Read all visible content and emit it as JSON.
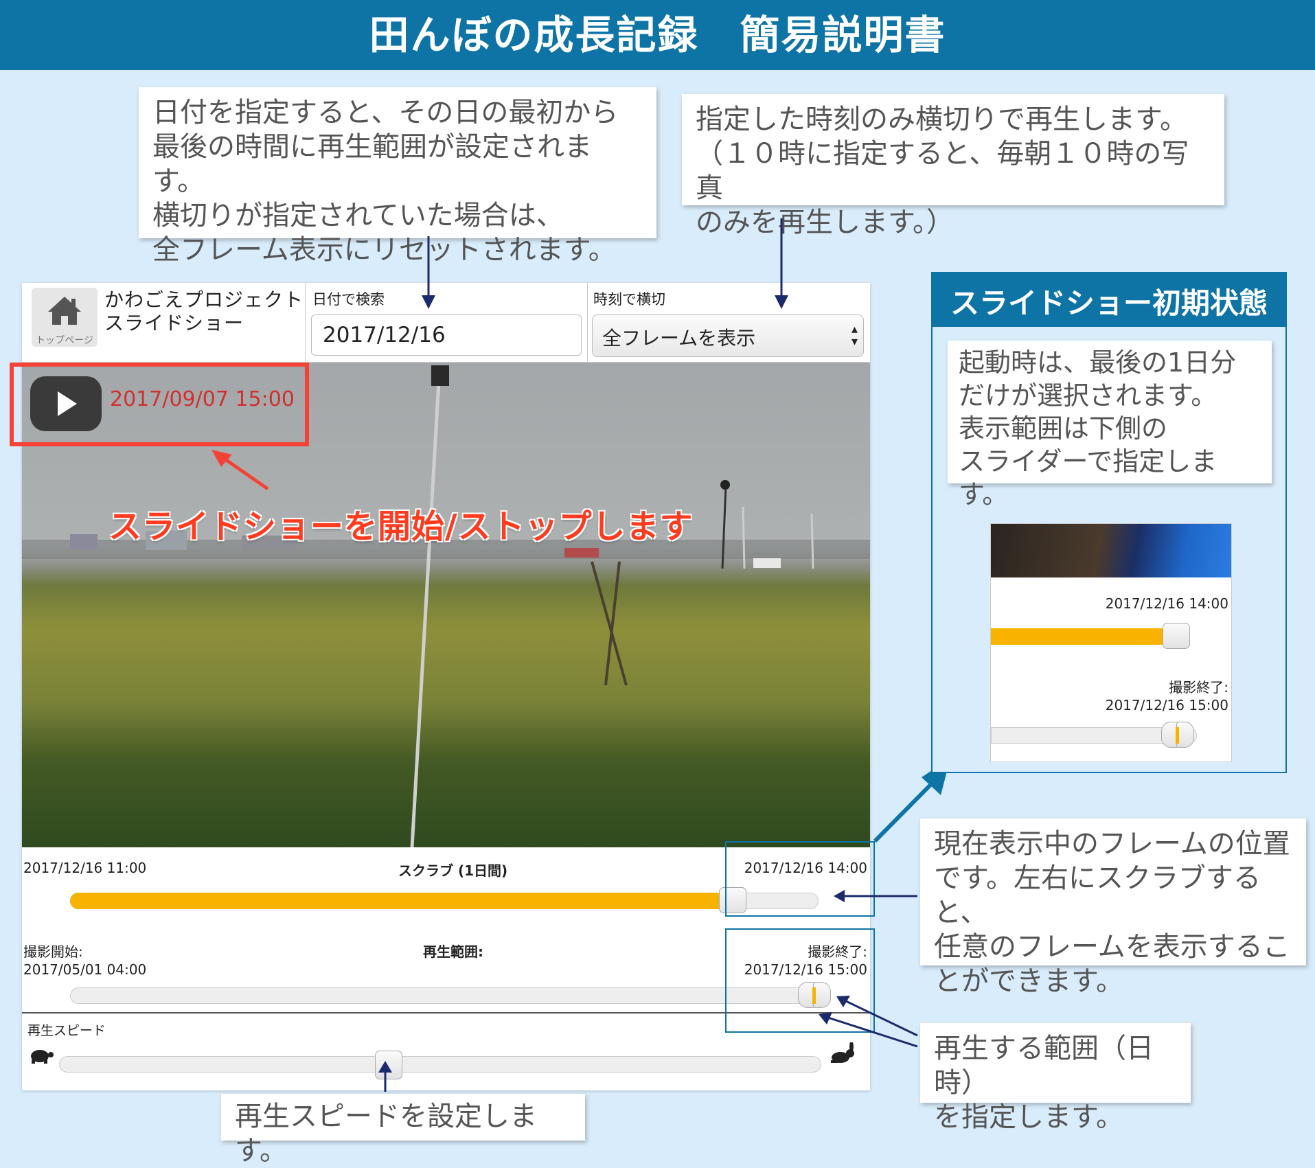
{
  "banner": {
    "title": "田んぼの成長記録　簡易説明書"
  },
  "notes": {
    "date": "日付を指定すると、その日の最初から\n最後の時間に再生範囲が設定されます。\n横切りが指定されていた場合は、\n全フレーム表示にリセットされます。",
    "time": "指定した時刻のみ横切りで再生します。\n（１０時に指定すると、毎朝１０時の写真\nのみを再生します。）",
    "play": "スライドショーを開始/ストップします",
    "frame": "現在表示中のフレームの位置\nです。左右にスクラブすると、\n任意のフレームを表示するこ\nとができます。",
    "range": "再生する範囲（日時）\nを指定します。",
    "speed": "再生スピードを設定します。"
  },
  "app": {
    "home_label": "トップページ",
    "title": "かわごえプロジェクト\nスライドショー",
    "date_label": "日付で検索",
    "date_value": "2017/12/16",
    "time_label": "時刻で横切",
    "time_value": "全フレームを表示",
    "current_time": "2017/09/07 15:00",
    "scrub": {
      "start": "2017/12/16 11:00",
      "label": "スクラブ (1日間)",
      "end": "2017/12/16 14:00",
      "position": 0.9
    },
    "range": {
      "start_label": "撮影開始:",
      "start_value": "2017/05/01 04:00",
      "label": "再生範囲:",
      "end_label": "撮影終了:",
      "end_value": "2017/12/16 15:00"
    },
    "speed": {
      "label": "再生スピード",
      "value": 0.43
    }
  },
  "init_panel": {
    "title": "スライドショー初期状態",
    "note": "起動時は、最後の1日分\nだけが選択されます。\n表示範囲は下側の\nスライダーで指定します。",
    "scrub_time": "2017/12/16 14:00",
    "end_label": "撮影終了:",
    "end_value": "2017/12/16 15:00"
  },
  "colors": {
    "accent": "#0e74a6",
    "slider": "#f7b300",
    "highlight": "#f44336",
    "navy": "#1a2a6c"
  }
}
